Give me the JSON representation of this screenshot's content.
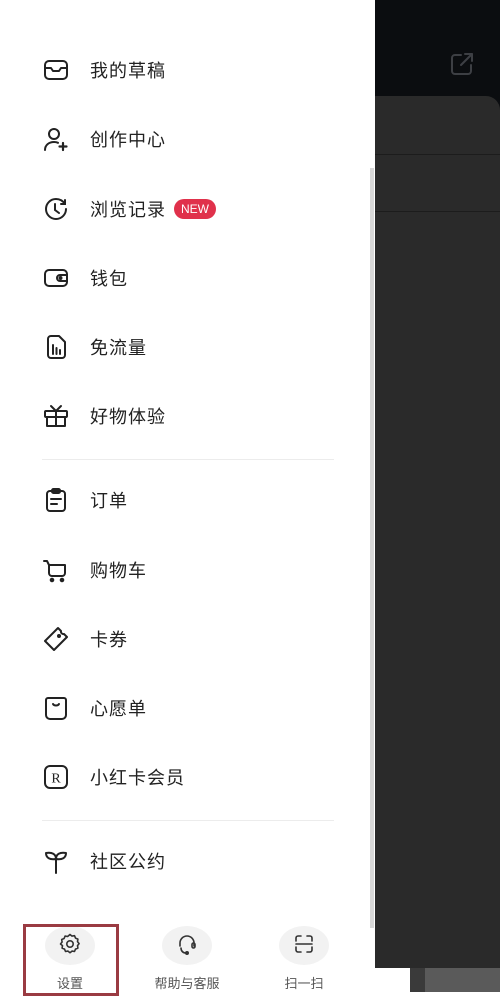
{
  "menu": {
    "group1": [
      {
        "label": "我的草稿",
        "icon": "drafts-inbox-icon"
      },
      {
        "label": "创作中心",
        "icon": "creator-center-icon"
      },
      {
        "label": "浏览记录",
        "icon": "history-clock-icon",
        "badge": "NEW"
      },
      {
        "label": "钱包",
        "icon": "wallet-icon"
      },
      {
        "label": "免流量",
        "icon": "data-free-sim-icon"
      },
      {
        "label": "好物体验",
        "icon": "gift-icon"
      }
    ],
    "group2": [
      {
        "label": "订单",
        "icon": "orders-clipboard-icon"
      },
      {
        "label": "购物车",
        "icon": "shopping-cart-icon"
      },
      {
        "label": "卡券",
        "icon": "coupon-ticket-icon"
      },
      {
        "label": "心愿单",
        "icon": "wishlist-bag-icon"
      },
      {
        "label": "小红卡会员",
        "icon": "membership-r-icon"
      }
    ],
    "group3": [
      {
        "label": "社区公约",
        "icon": "sprout-icon"
      }
    ]
  },
  "bottom_actions": [
    {
      "label": "设置",
      "icon": "gear-icon"
    },
    {
      "label": "帮助与客服",
      "icon": "headset-icon"
    },
    {
      "label": "扫一扫",
      "icon": "scan-icon"
    }
  ],
  "colors": {
    "badge": "#e0314b",
    "highlight_box": "#9a3b42",
    "overlay_dark": "#0b0d10",
    "sheet": "#2a2a2a"
  }
}
